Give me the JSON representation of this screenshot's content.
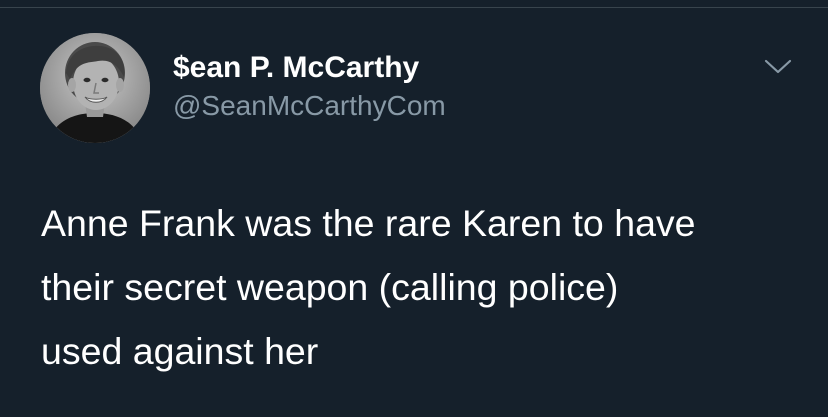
{
  "tweet": {
    "author": {
      "display_name": "$ean P. McCarthy",
      "handle": "@SeanMcCarthyCom",
      "avatar_icon": "profile-photo"
    },
    "menu_icon": "chevron-down-icon",
    "text": "Anne Frank was the rare Karen to have\ntheir secret weapon (calling police)\nused against her"
  },
  "colors": {
    "background": "#15202b",
    "primary_text": "#ffffff",
    "secondary_text": "#8899a6",
    "divider": "#38444d"
  }
}
